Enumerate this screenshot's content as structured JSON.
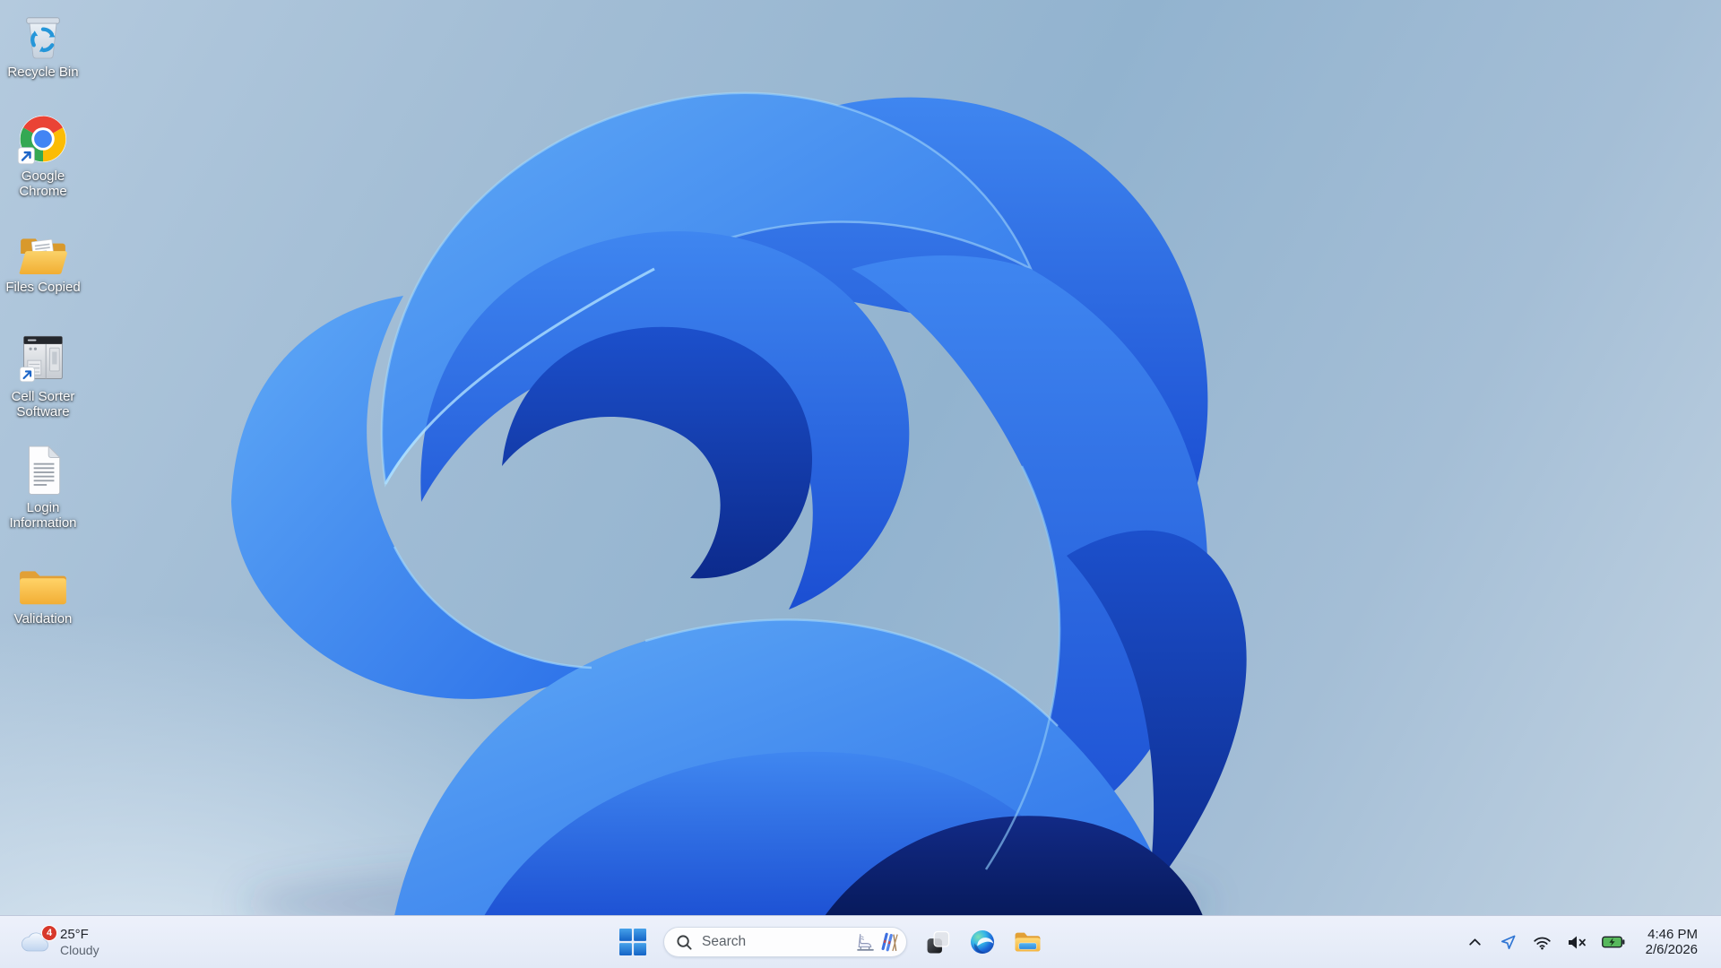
{
  "desktop": {
    "icons": [
      {
        "name": "recycle-bin",
        "label": "Recycle Bin",
        "shortcut": false
      },
      {
        "name": "google-chrome",
        "label": "Google Chrome",
        "shortcut": true
      },
      {
        "name": "files-copied-folder",
        "label": "Files Copied",
        "shortcut": false
      },
      {
        "name": "cell-sorter-software",
        "label": "Cell Sorter Software",
        "shortcut": true
      },
      {
        "name": "login-information",
        "label": "Login Information",
        "shortcut": false
      },
      {
        "name": "validation-folder",
        "label": "Validation",
        "shortcut": false
      }
    ]
  },
  "taskbar": {
    "weather": {
      "temperature": "25°F",
      "condition": "Cloudy",
      "badge_count": "4",
      "icon": "cloud-icon"
    },
    "search": {
      "placeholder": "Search",
      "decor_icons": [
        "ice-skate-icon",
        "skis-icon"
      ]
    },
    "app_buttons": [
      "start",
      "task-view",
      "microsoft-edge",
      "file-explorer"
    ],
    "tray": {
      "icons": [
        "chevron-up",
        "location-in-use",
        "wifi",
        "volume-muted",
        "battery-charging"
      ],
      "time": "4:46 PM",
      "date": "2/6/2026"
    }
  },
  "colors": {
    "taskbar_background": "#e8eef8",
    "badge_red": "#d7382b",
    "battery_green": "#55b85a",
    "windows_blue": "#2c7fdc",
    "bloom_deep_blue": "#0c2a8c",
    "bloom_light_blue": "#5aa4f5"
  }
}
